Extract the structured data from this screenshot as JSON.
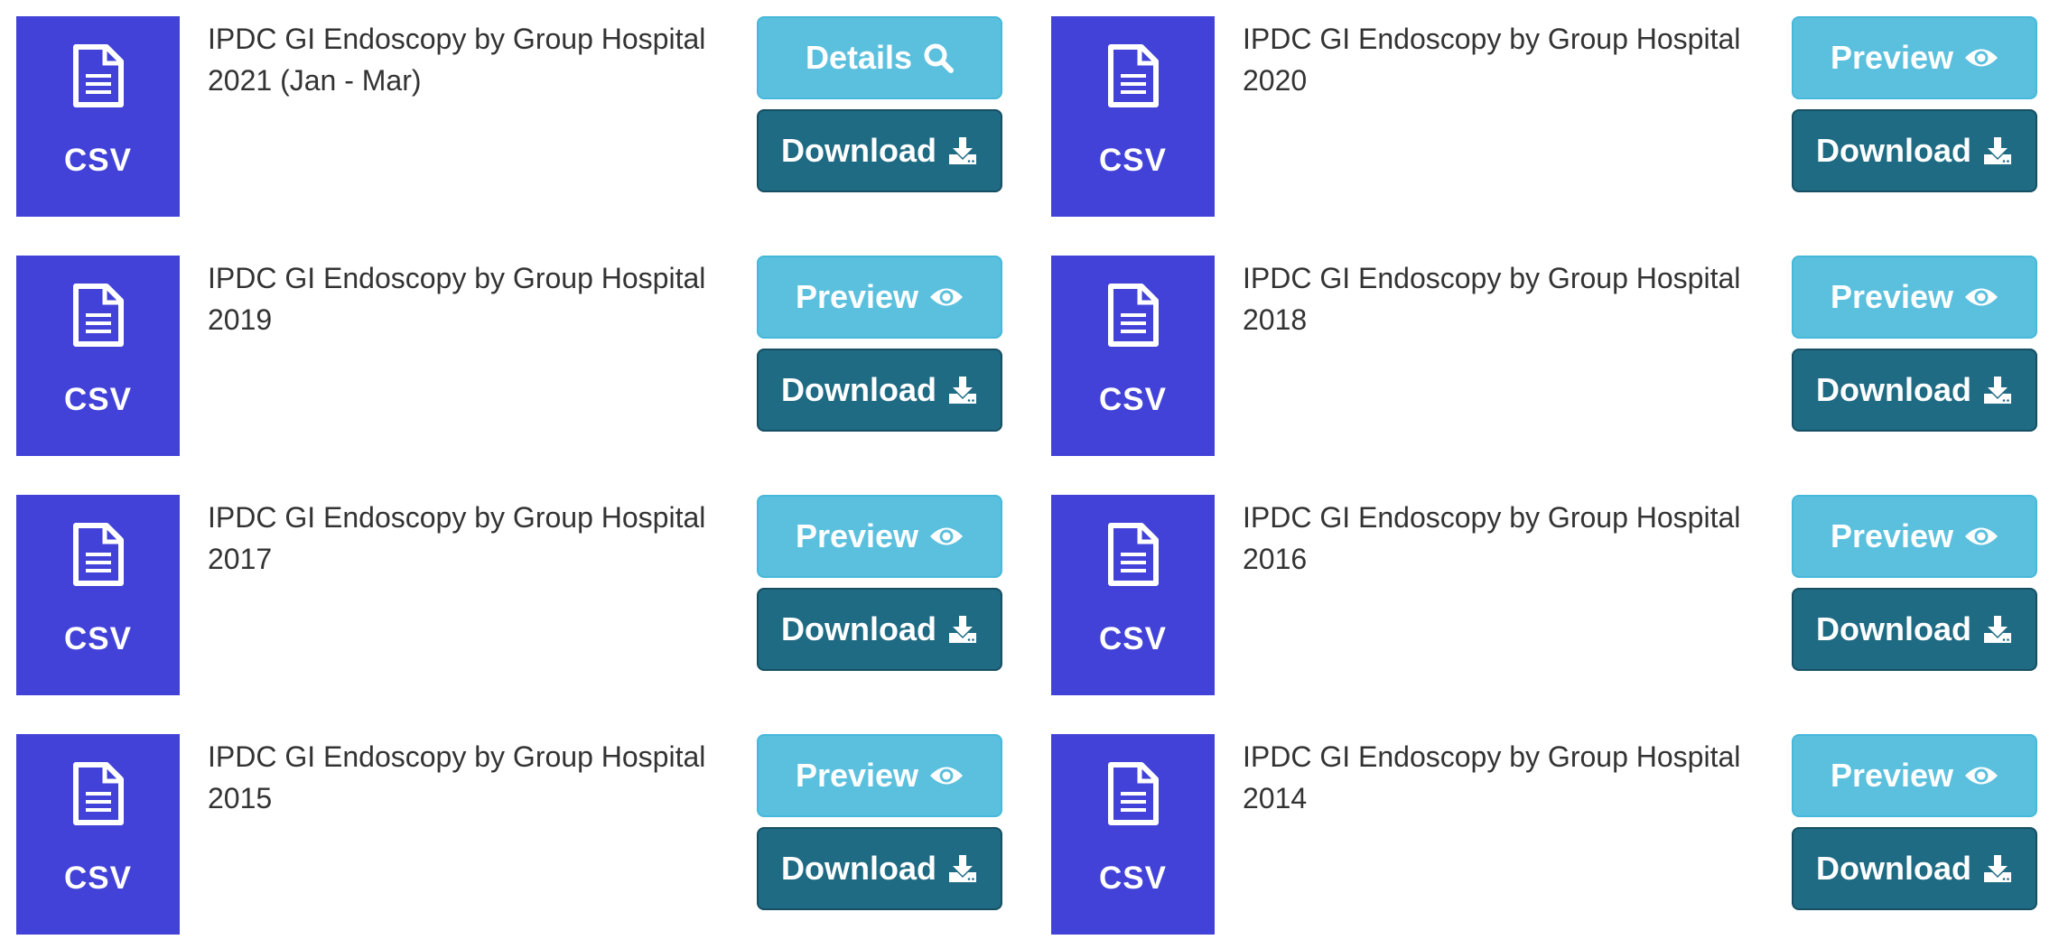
{
  "colors": {
    "tile": "#4242d9",
    "button_light": "#5bc0de",
    "button_dark": "#1f6b84",
    "title_text": "#333333"
  },
  "resources": [
    {
      "title": "IPDC GI Endoscopy by Group Hospital 2021 (Jan - Mar)",
      "format": "CSV",
      "primary_label": "Details",
      "primary_icon": "search-icon",
      "download_label": "Download",
      "download_icon": "download-icon"
    },
    {
      "title": "IPDC GI Endoscopy by Group Hospital 2020",
      "format": "CSV",
      "primary_label": "Preview",
      "primary_icon": "eye-icon",
      "download_label": "Download",
      "download_icon": "download-icon"
    },
    {
      "title": "IPDC GI Endoscopy by Group Hospital 2019",
      "format": "CSV",
      "primary_label": "Preview",
      "primary_icon": "eye-icon",
      "download_label": "Download",
      "download_icon": "download-icon"
    },
    {
      "title": "IPDC GI Endoscopy by Group Hospital 2018",
      "format": "CSV",
      "primary_label": "Preview",
      "primary_icon": "eye-icon",
      "download_label": "Download",
      "download_icon": "download-icon"
    },
    {
      "title": "IPDC GI Endoscopy by Group Hospital 2017",
      "format": "CSV",
      "primary_label": "Preview",
      "primary_icon": "eye-icon",
      "download_label": "Download",
      "download_icon": "download-icon"
    },
    {
      "title": "IPDC GI Endoscopy by Group Hospital 2016",
      "format": "CSV",
      "primary_label": "Preview",
      "primary_icon": "eye-icon",
      "download_label": "Download",
      "download_icon": "download-icon"
    },
    {
      "title": "IPDC GI Endoscopy by Group Hospital 2015",
      "format": "CSV",
      "primary_label": "Preview",
      "primary_icon": "eye-icon",
      "download_label": "Download",
      "download_icon": "download-icon"
    },
    {
      "title": "IPDC GI Endoscopy by Group Hospital 2014",
      "format": "CSV",
      "primary_label": "Preview",
      "primary_icon": "eye-icon",
      "download_label": "Download",
      "download_icon": "download-icon"
    }
  ]
}
